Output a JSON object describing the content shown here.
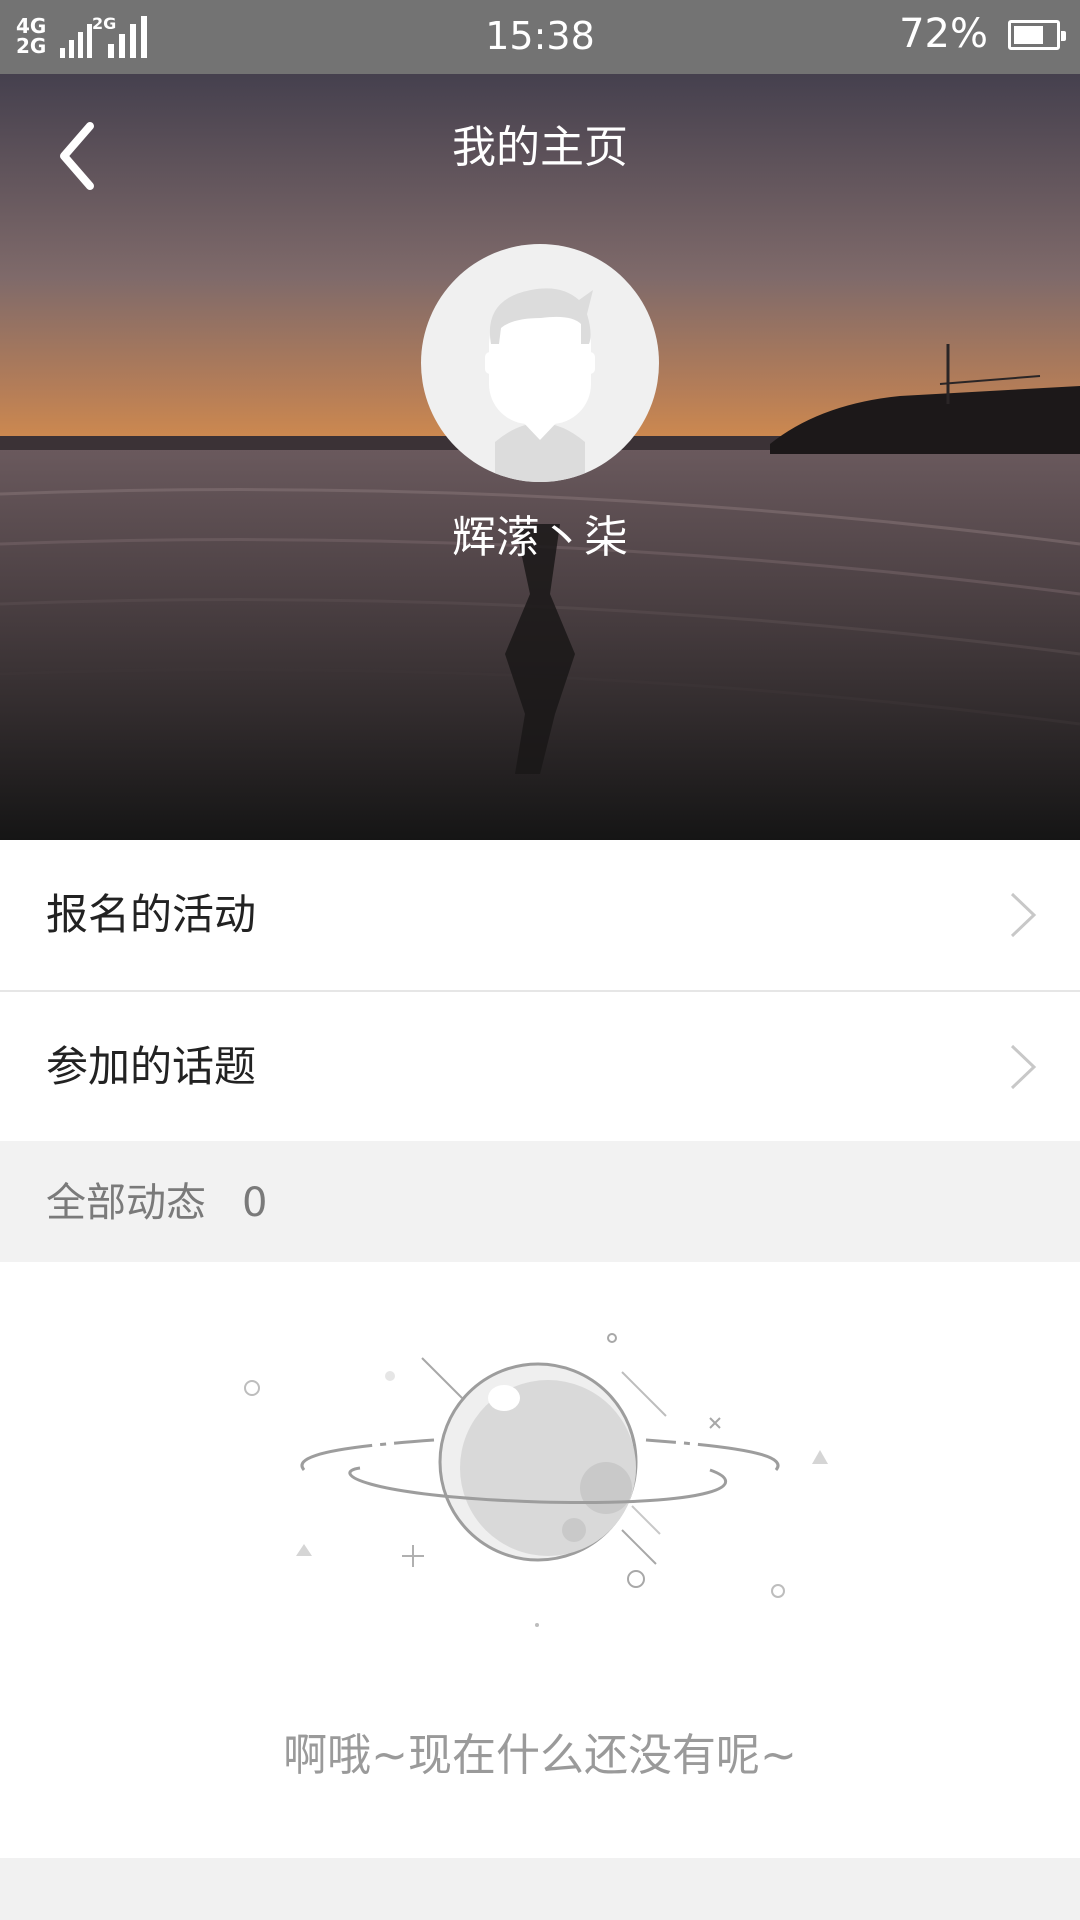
{
  "status_bar": {
    "network_top": "4G",
    "network_bottom": "2G",
    "network_second": "2G",
    "time": "15:38",
    "battery_text": "72%",
    "battery_level": 0.72
  },
  "header": {
    "title": "我的主页",
    "back_icon": "chevron-left-icon"
  },
  "profile": {
    "avatar_icon": "default-avatar-icon",
    "username": "辉潆丶柒"
  },
  "menu": {
    "items": [
      {
        "label": "报名的活动",
        "icon": "chevron-right-icon"
      },
      {
        "label": "参加的话题",
        "icon": "chevron-right-icon"
      }
    ]
  },
  "feed": {
    "label": "全部动态",
    "count": "0"
  },
  "empty_state": {
    "illustration_icon": "planet-icon",
    "message": "啊哦~现在什么还没有呢~"
  },
  "colors": {
    "status_bar": "#737373",
    "section_bg": "#f2f2f2",
    "text_primary": "#222222",
    "text_muted": "#9a9a9a"
  }
}
